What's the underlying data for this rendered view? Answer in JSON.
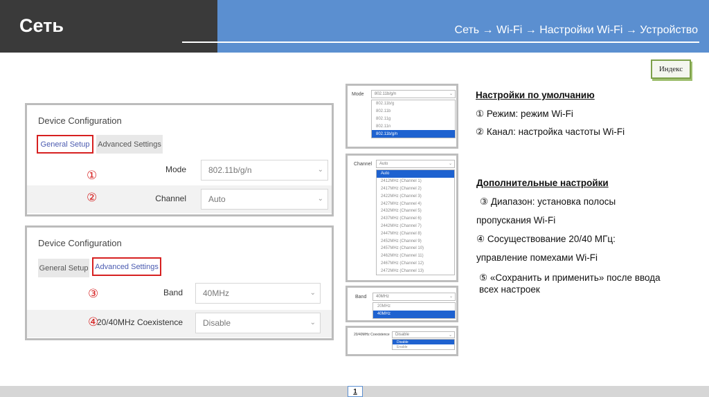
{
  "header": {
    "title": "Сеть",
    "breadcrumb": "Сеть → Wi-Fi → Настройки Wi-Fi → Устройство"
  },
  "index_button": "Индекс",
  "panel_general": {
    "title": "Device Configuration",
    "tab_general": "General Setup",
    "tab_advanced": "Advanced Settings",
    "marker_1": "①",
    "marker_2": "②",
    "mode_label": "Mode",
    "mode_value": "802.11b/g/n",
    "channel_label": "Channel",
    "channel_value": "Auto"
  },
  "panel_advanced": {
    "title": "Device Configuration",
    "tab_general": "General Setup",
    "tab_advanced": "Advanced Settings",
    "marker_3": "③",
    "marker_4": "④",
    "band_label": "Band",
    "band_value": "40MHz",
    "coex_label": "20/40MHz Coexistence",
    "coex_value": "Disable"
  },
  "shot_mode": {
    "label": "Mode",
    "value": "802.11b/g/n",
    "options": [
      "802.11b/g",
      "802.11b",
      "802.11g",
      "802.11n",
      "802.11b/g/n"
    ],
    "selected_index": 4
  },
  "shot_channel": {
    "label": "Channel",
    "value": "Auto",
    "options": [
      "Auto",
      "2412MHz (Channel 1)",
      "2417MHz (Channel 2)",
      "2422MHz (Channel 3)",
      "2427MHz (Channel 4)",
      "2432MHz (Channel 5)",
      "2437MHz (Channel 6)",
      "2442MHz (Channel 7)",
      "2447MHz (Channel 8)",
      "2452MHz (Channel 9)",
      "2457MHz (Channel 10)",
      "2462MHz (Channel 11)",
      "2467MHz (Channel 12)",
      "2472MHz (Channel 13)"
    ],
    "selected_index": 0
  },
  "shot_band": {
    "label": "Band",
    "value": "40MHz",
    "options": [
      "20MHz",
      "40MHz"
    ],
    "selected_index": 1
  },
  "shot_coex": {
    "label": "20/40MHz Coexistence",
    "value": "Disable",
    "options": [
      "Disable",
      "Enable"
    ],
    "selected_index": 0
  },
  "right_text": {
    "default_heading": "Настройки по умолчанию",
    "item1": "① Режим: режим Wi-Fi",
    "item2": "② Канал: настройка частоты Wi-Fi",
    "advanced_heading": "Дополнительные настройки",
    "item3_line1": "③ Диапазон: установка полосы",
    "item3_line2": "пропускания Wi-Fi",
    "item4_line1": "④ Сосуществование 20/40 МГц:",
    "item4_line2": "управление помехами Wi-Fi",
    "item5_line1": "⑤ «Сохранить и применить» после ввода",
    "item5_line2": "всех настроек"
  },
  "page_number": "1",
  "colors": {
    "header_dark": "#3a3a3a",
    "header_blue": "#5b8fd0",
    "highlight_red": "#d62020",
    "selection_blue": "#1e62d0",
    "index_green": "#7da04a"
  }
}
